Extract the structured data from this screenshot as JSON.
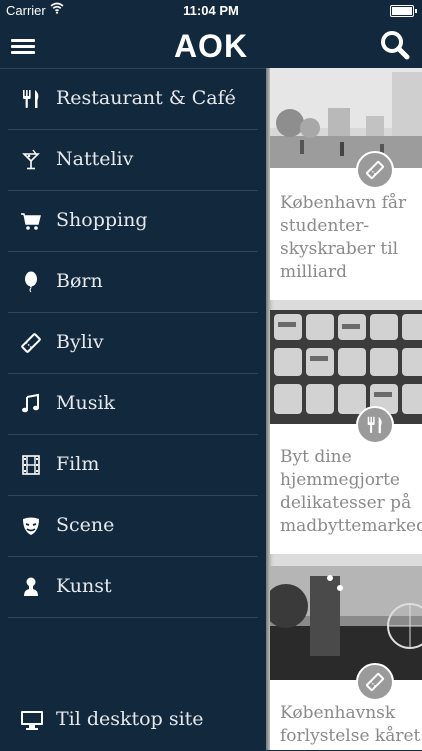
{
  "statusbar": {
    "carrier": "Carrier",
    "time": "11:04 PM"
  },
  "app": {
    "brand": "AOK"
  },
  "sidebar": {
    "items": [
      {
        "label": "Restaurant & Café",
        "icon": "fork-knife-icon"
      },
      {
        "label": "Natteliv",
        "icon": "cocktail-icon"
      },
      {
        "label": "Shopping",
        "icon": "shopping-cart-icon"
      },
      {
        "label": "Børn",
        "icon": "balloon-icon"
      },
      {
        "label": "Byliv",
        "icon": "ticket-icon"
      },
      {
        "label": "Musik",
        "icon": "music-note-icon"
      },
      {
        "label": "Film",
        "icon": "film-strip-icon"
      },
      {
        "label": "Scene",
        "icon": "theater-mask-icon"
      },
      {
        "label": "Kunst",
        "icon": "bust-icon"
      }
    ],
    "desktop_link": {
      "label": "Til desktop site",
      "icon": "monitor-icon"
    }
  },
  "feed": {
    "cards": [
      {
        "title": "København får\nstudenter-\nskyskraber til\nmilliard",
        "badge_icon": "ticket-icon"
      },
      {
        "title": "Byt dine\nhjemmegjorte\ndelikatesser på\nmadbyttemarked",
        "badge_icon": "fork-knife-icon"
      },
      {
        "title": "Københavnsk\nforlystelse kåret",
        "badge_icon": "ticket-icon"
      }
    ]
  },
  "colors": {
    "sidebar_bg": "#12283c",
    "divider": "#2f4559",
    "card_text": "#8a8a8a",
    "badge": "#9a9a9a"
  }
}
